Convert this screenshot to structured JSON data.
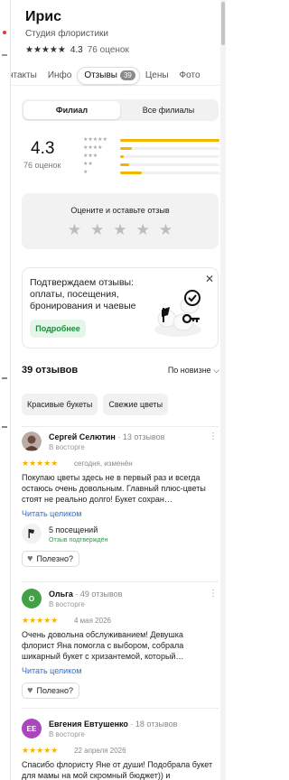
{
  "place": {
    "title": "Ирис",
    "subtitle": "Студия флористики",
    "stars": "★★★★★",
    "rating": "4.3",
    "reviews_count": "76 оценок"
  },
  "tabs": [
    {
      "label": "нтакты"
    },
    {
      "label": "Инфо"
    },
    {
      "label": "Отзывы",
      "badge": "39"
    },
    {
      "label": "Цены"
    },
    {
      "label": "Фото"
    }
  ],
  "branch_toggle": {
    "branch": "Филиал",
    "all": "Все филиалы"
  },
  "summary": {
    "rating": "4.3",
    "count": "76 оценок",
    "distribution": [
      {
        "stars": "★★★★★",
        "fraction": 1.0
      },
      {
        "stars": "★★★★",
        "fraction": 0.12
      },
      {
        "stars": "★★★",
        "fraction": 0.04
      },
      {
        "stars": "★★",
        "fraction": 0.09
      },
      {
        "stars": "★",
        "fraction": 0.22
      }
    ]
  },
  "rate_prompt": {
    "title": "Оцените и оставьте отзыв",
    "stars": [
      "★",
      "★",
      "★",
      "★",
      "★"
    ]
  },
  "promo": {
    "text": "Подтверждаем отзывы: оплаты, посещения, бронирования и чаевые",
    "button": "Подробнее",
    "close": "✕"
  },
  "reviews_header": {
    "count": "39 отзывов",
    "sort": "По новизне ⌵"
  },
  "chips": [
    "Красивые букеты",
    "Свежие цветы"
  ],
  "reviews": [
    {
      "name": "Сергей Селютин",
      "meta": "· 13 отзывов",
      "subtitle": "В восторге",
      "stars": "★★★★★",
      "date": "сегодня, изменён",
      "text": "Покупаю цветы здесь не в первый раз и всегда остаюсь очень довольным. Главный плюс-цветы стоят не реально долго! Букет сохран…",
      "link": "Читать целиком",
      "visits": "5 посещений",
      "verified": "Отзыв подтверждён",
      "useful": "Полезно?",
      "avatar_initials": "",
      "avatar_color": "#8d6e63"
    },
    {
      "name": "Ольга",
      "meta": "· 49 отзывов",
      "subtitle": "В восторге",
      "stars": "★★★★★",
      "date": "4 мая 2026",
      "text": "Очень довольна обслуживанием! Девушка флорист Яна помогла с выбором, собрала шикарный букет с хризантемой, который…",
      "link": "Читать целиком",
      "useful": "Полезно?",
      "avatar_initials": "О",
      "avatar_color": "#43a047"
    },
    {
      "name": "Евгения Евтушенко",
      "meta": "· 18 отзывов",
      "subtitle": "В восторге",
      "stars": "★★★★★",
      "date": "22 апреля 2026",
      "text": "Спасибо флористу Яне от души! Подобрала букет для мамы на мой скромный бюджет)) и",
      "avatar_initials": "ЕЕ",
      "avatar_color": "#ab47bc"
    }
  ],
  "more_glyph": "⋮"
}
